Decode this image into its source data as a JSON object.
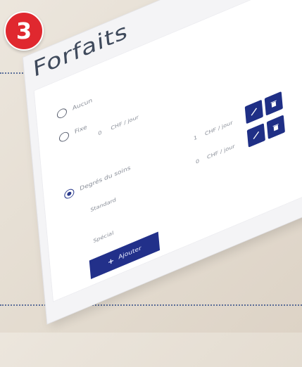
{
  "badge": {
    "number": "3",
    "color": "#e0282f"
  },
  "title": "Forfaits",
  "options": [
    {
      "label": "Aucun",
      "checked": false
    },
    {
      "label": "Fixe",
      "checked": false,
      "amount": "0",
      "unit": "CHF / jour"
    },
    {
      "label": "Degrés du soins",
      "checked": true
    }
  ],
  "rows": [
    {
      "amount": "1",
      "unit": "CHF / jour",
      "label": "Standard"
    },
    {
      "amount": "0",
      "unit": "CHF / jour",
      "label": "Spécial"
    }
  ],
  "icons": {
    "edit": "pencil-icon",
    "delete": "trash-icon"
  },
  "add_button": {
    "plus": "+",
    "label": "Ajouter"
  },
  "colors": {
    "accent": "#1f2f86",
    "badge": "#e0282f"
  }
}
